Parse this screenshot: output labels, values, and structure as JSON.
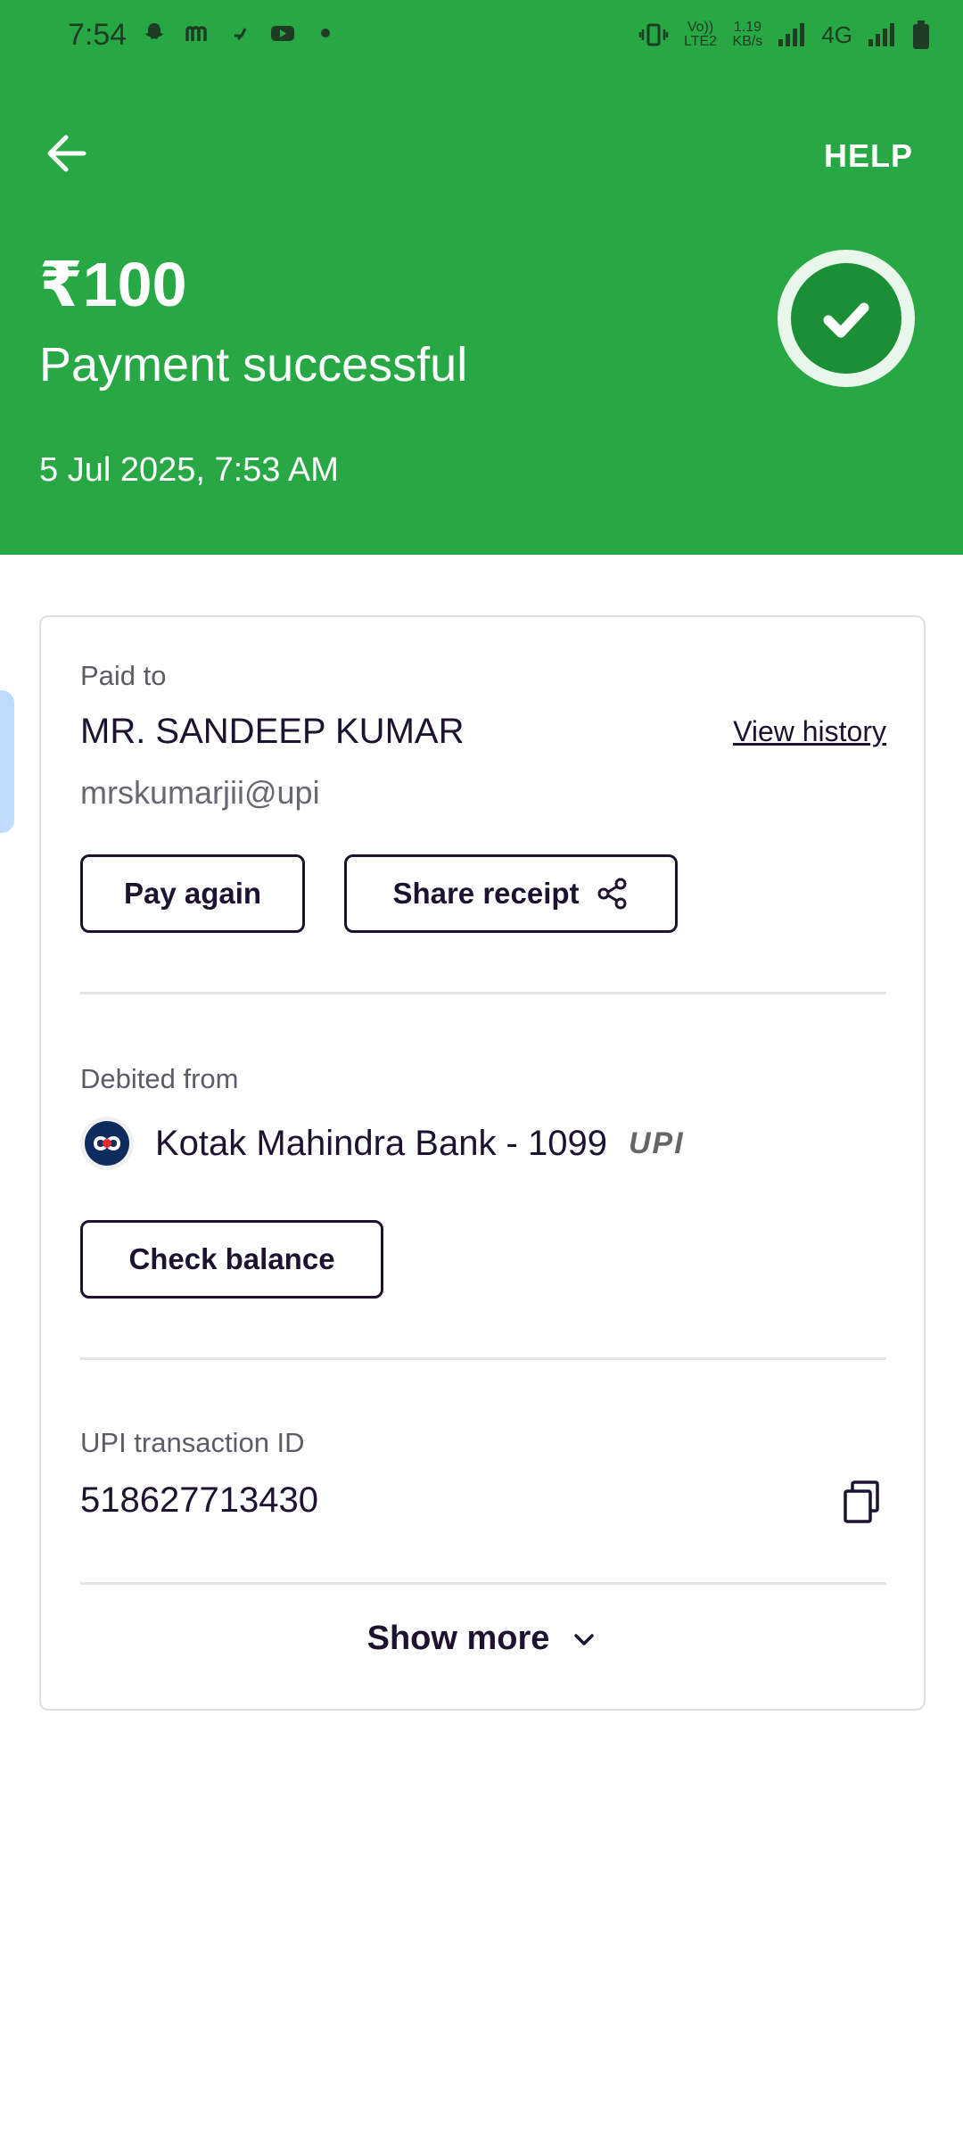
{
  "status_bar": {
    "time": "7:54",
    "speed": "1.19",
    "speed_unit": "KB/s",
    "network": "4G",
    "volte": "Vo)) LTE2"
  },
  "header": {
    "help_label": "HELP",
    "amount": "₹100",
    "status": "Payment successful",
    "datetime": "5 Jul 2025, 7:53 AM",
    "accent_color": "#27a844"
  },
  "paid_to": {
    "label": "Paid to",
    "name": "MR. SANDEEP  KUMAR",
    "upi_id": "mrskumarjii@upi",
    "view_history_label": "View history",
    "pay_again_label": "Pay again",
    "share_receipt_label": "Share receipt"
  },
  "debited_from": {
    "label": "Debited from",
    "bank": "Kotak Mahindra Bank - 1099",
    "upi_logo": "UPI",
    "check_balance_label": "Check balance"
  },
  "transaction": {
    "label": "UPI transaction ID",
    "id": "518627713430"
  },
  "show_more_label": "Show more",
  "icons": {
    "back": "arrow-left-icon",
    "success": "check-circle-icon",
    "share": "share-icon",
    "copy": "copy-icon",
    "chevron": "chevron-down-icon"
  }
}
